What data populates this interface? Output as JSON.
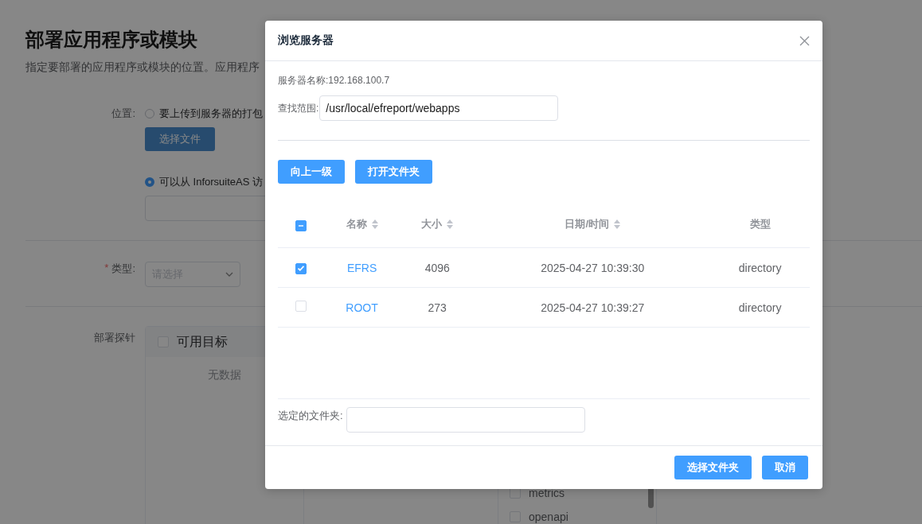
{
  "page": {
    "title": "部署应用程序或模块",
    "subtitle": "指定要部署的应用程序或模块的位置。应用程序"
  },
  "location": {
    "label": "位置:",
    "options": [
      {
        "label": "要上传到服务器的打包",
        "selected": false
      },
      {
        "label": "可以从 InforsuiteAS 访",
        "selected": true
      }
    ],
    "choose_file_button": {
      "label": "选择文件",
      "disabled": true
    }
  },
  "type": {
    "label": "类型:",
    "required_mark": "*",
    "placeholder": "请选择"
  },
  "probe": {
    "label": "部署探针",
    "available": {
      "title": "可用目标",
      "checked": false,
      "empty_text": "无数据"
    },
    "targets": [
      {
        "label": "metrics",
        "checked": false
      },
      {
        "label": "openapi",
        "checked": false
      }
    ]
  },
  "dialog": {
    "title": "浏览服务器",
    "server_name": "服务器名称:192.168.100.7",
    "search_scope": {
      "label": "查找范围:",
      "value": "/usr/local/efreport/webapps"
    },
    "buttons": [
      "向上一级",
      "打开文件夹"
    ],
    "table": {
      "select_all_indeterminate": true,
      "columns": [
        {
          "label": "名称",
          "sortable": true
        },
        {
          "label": "大小",
          "sortable": true
        },
        {
          "label": "日期/时间",
          "sortable": true
        },
        {
          "label": "类型",
          "sortable": false
        }
      ],
      "rows": [
        {
          "checked": true,
          "name": "EFRS",
          "size": "4096",
          "date": "2025-04-27 10:39:30",
          "type": "directory"
        },
        {
          "checked": false,
          "name": "ROOT",
          "size": "273",
          "date": "2025-04-27 10:39:27",
          "type": "directory"
        }
      ]
    },
    "selected_folder": {
      "label": "选定的文件夹:"
    },
    "footer_buttons": [
      "选择文件夹",
      "取消"
    ]
  }
}
